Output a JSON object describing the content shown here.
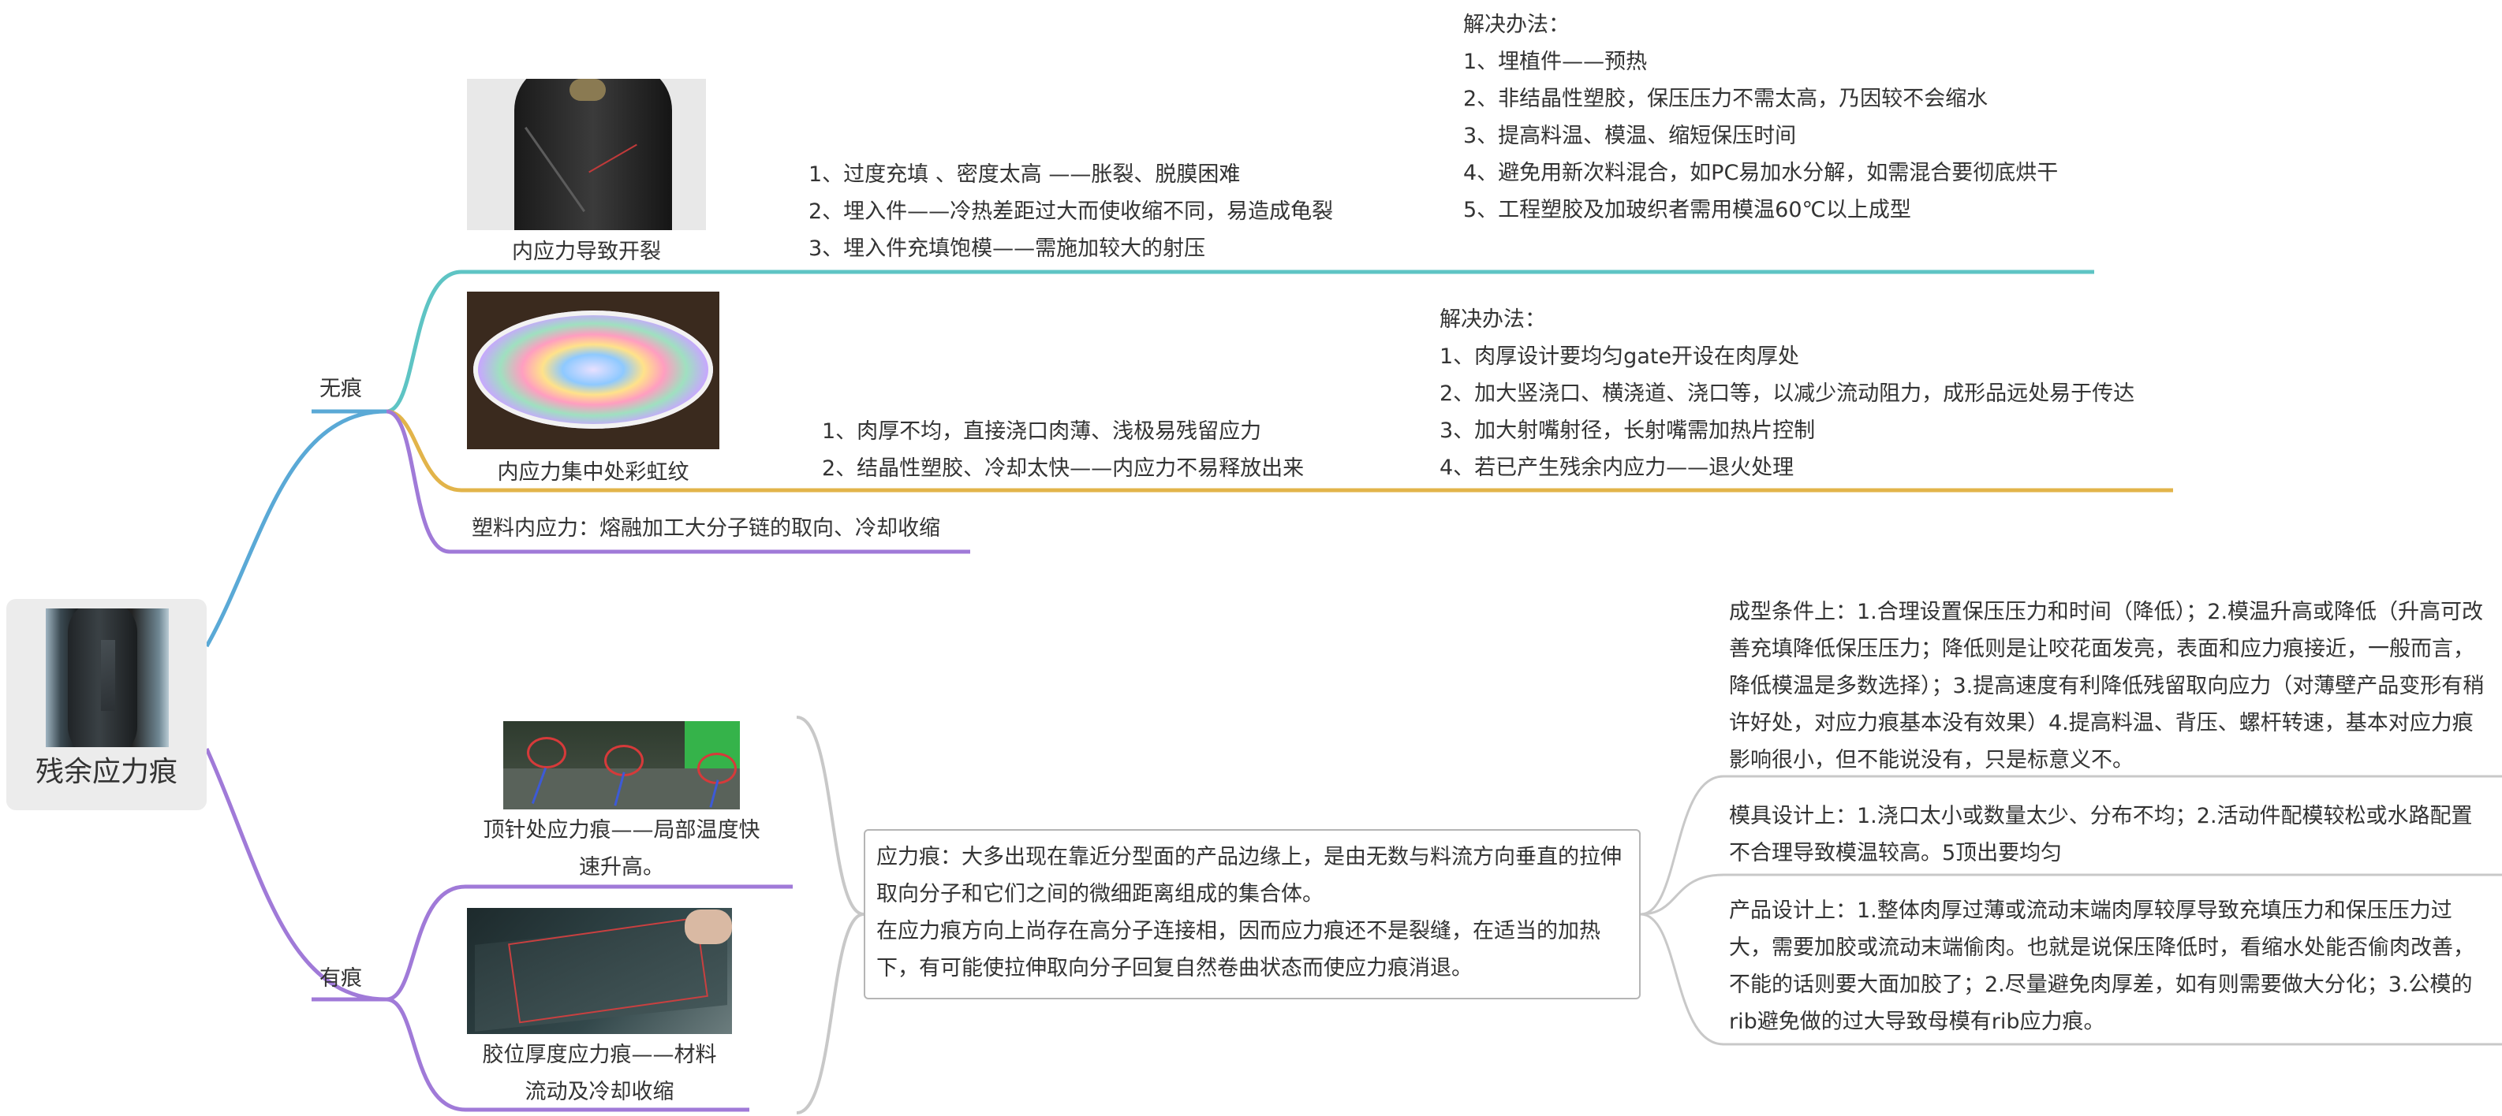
{
  "root": {
    "label": "残余应力痕",
    "icon": "phone-photo"
  },
  "branches": {
    "wuhen": {
      "label": "无痕",
      "color": "#5aa9d6",
      "crack": {
        "caption": "内应力导致开裂",
        "causes": [
          "1、过度充填 、密度太高 ——胀裂、脱膜困难",
          "2、埋入件——冷热差距过大而使收缩不同，易造成龟裂",
          "3、埋入件充填饱模——需施加较大的射压"
        ],
        "solution_title": "解决办法：",
        "solutions": [
          "1、埋植件——预热",
          "2、非结晶性塑胶，保压压力不需太高，乃因较不会缩水",
          "3、提高料温、模温、缩短保压时间",
          "4、避免用新次料混合，如PC易加水分解，如需混合要彻底烘干",
          "5、工程塑胶及加玻织者需用模温60℃以上成型"
        ],
        "color": "#5ec4c4"
      },
      "rainbow": {
        "caption": "内应力集中处彩虹纹",
        "causes": [
          "1、肉厚不均，直接浇口肉薄、浅极易残留应力",
          "2、结晶性塑胶、冷却太快——内应力不易释放出来"
        ],
        "solution_title": "解决办法：",
        "solutions": [
          "1、肉厚设计要均匀gate开设在肉厚处",
          "2、加大竖浇口、横浇道、浇口等，以减少流动阻力，成形品远处易于传达",
          "3、加大射嘴射径，长射嘴需加热片控制",
          "4、若已产生残余内应力——退火处理"
        ],
        "color": "#e2b44a"
      },
      "plastic_stress": {
        "label": "塑料内应力：熔融加工大分子链的取向、冷却收缩",
        "color": "#a07ad8"
      }
    },
    "youhen": {
      "label": "有痕",
      "color": "#a07ad8",
      "ejector": {
        "caption_lines": [
          "顶针处应力痕——局部温度快",
          "速升高。"
        ]
      },
      "thickness": {
        "caption_lines": [
          "胶位厚度应力痕——材料",
          "流动及冷却收缩"
        ]
      },
      "definition": [
        "应力痕：大多出现在靠近分型面的产品边缘上，是由无数与料流方向垂直的拉伸取向分子和它们之间的微细距离组成的集合体。",
        "在应力痕方向上尚存在高分子连接相，因而应力痕还不是裂缝，在适当的加热下，有可能使拉伸取向分子回复自然卷曲状态而使应力痕消退。"
      ],
      "design": {
        "molding": "成型条件上：1.合理设置保压压力和时间（降低）；2.模温升高或降低（升高可改善充填降低保压压力；降低则是让咬花面发亮，表面和应力痕接近，一般而言，降低模温是多数选择）；3.提高速度有利降低残留取向应力（对薄壁产品变形有稍许好处，对应力痕基本没有效果）4.提高料温、背压、螺杆转速，基本对应力痕影响很小，但不能说没有，只是标意义不。",
        "mold": "模具设计上：1.浇口太小或数量太少、分布不均；2.活动件配模较松或水路配置不合理导致模温较高。5顶出要均匀",
        "product": "产品设计上：1.整体肉厚过薄或流动末端肉厚较厚导致充填压力和保压压力过大，需要加胶或流动末端偷肉。也就是说保压降低时，看缩水处能否偷肉改善，不能的话则要大面加胶了；2.尽量避免肉厚差，如有则需要做大分化；3.公模的rib避免做的过大导致母模有rib应力痕。"
      }
    }
  }
}
